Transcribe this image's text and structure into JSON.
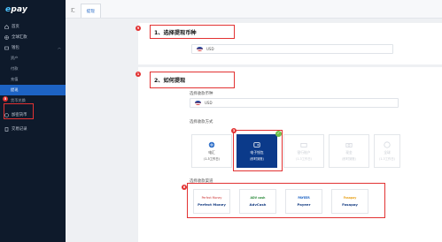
{
  "brand": {
    "logo_e": "e",
    "logo_rest": "pay"
  },
  "sidebar": {
    "items": [
      {
        "label": "首页",
        "icon": "home-icon"
      },
      {
        "label": "全球汇款",
        "icon": "globe-icon"
      },
      {
        "label": "钱包",
        "icon": "wallet-icon"
      }
    ],
    "sub_items": [
      {
        "label": "资产"
      },
      {
        "label": "付款"
      },
      {
        "label": "充值"
      },
      {
        "label": "提现"
      },
      {
        "label": "货币兑换"
      }
    ],
    "bottom_items": [
      {
        "label": "加密货币",
        "icon": "crypto-icon"
      },
      {
        "label": "交易记录",
        "icon": "records-icon"
      }
    ]
  },
  "tabs": [
    {
      "label": "汇"
    },
    {
      "label": "提现"
    }
  ],
  "step1": {
    "badge": "9",
    "title": "1、选择提现币种",
    "currency": "USD"
  },
  "step2": {
    "badge": "1",
    "title": "2、如何提现",
    "receive_currency_label": "选择收款币种",
    "receive_currency": "USD",
    "method_label": "选择收款方式",
    "method_badge": "3",
    "methods": [
      {
        "name": "电汇",
        "sub": "(1-5工作日)"
      },
      {
        "name": "电子钱包",
        "sub": "(即时到账)"
      },
      {
        "name": "银行账户",
        "sub": "(1-3工作日)"
      },
      {
        "name": "现金",
        "sub": "(即时到账)"
      },
      {
        "name": "全球",
        "sub": "(1-3工作日)"
      }
    ],
    "channel_label": "选择收款渠道",
    "channel_badge": "6",
    "channels": [
      {
        "logo": "Perfect Money",
        "name": "Perfect Money"
      },
      {
        "logo": "ADV cash",
        "name": "AdvCash"
      },
      {
        "logo": "PAYEER",
        "name": "Payeer"
      },
      {
        "logo": "Fasapay",
        "name": "Fasapay"
      }
    ]
  },
  "sidebar_badge": "5",
  "colors": {
    "sidebar_bg": "#0e1a2b",
    "active": "#1d63c4",
    "selected_method": "#0b3a8a",
    "highlight": "#e23232",
    "check": "#6fc04a"
  }
}
